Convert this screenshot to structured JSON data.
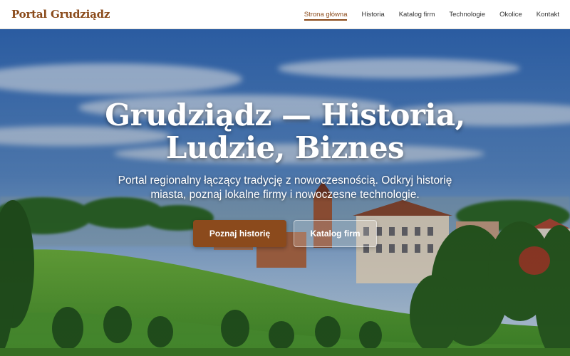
{
  "header": {
    "logo": "Portal Grudziądz",
    "nav": [
      {
        "label": "Strona główna",
        "active": true
      },
      {
        "label": "Historia",
        "active": false
      },
      {
        "label": "Katalog firm",
        "active": false
      },
      {
        "label": "Technologie",
        "active": false
      },
      {
        "label": "Okolice",
        "active": false
      },
      {
        "label": "Kontakt",
        "active": false
      }
    ]
  },
  "hero": {
    "title_line1": "Grudziądz — Historia,",
    "title_line2": "Ludzie, Biznes",
    "subtitle": "Portal regionalny łączący tradycję z nowoczesnością. Odkryj historię miasta, poznaj lokalne firmy i nowoczesne technologie.",
    "primary_button": "Poznaj historię",
    "secondary_button": "Katalog firm"
  },
  "colors": {
    "brand": "#8a4a1a",
    "primary_button": "#8b4a1c",
    "sky": "#3f78c0",
    "grass": "#5fa83a"
  }
}
